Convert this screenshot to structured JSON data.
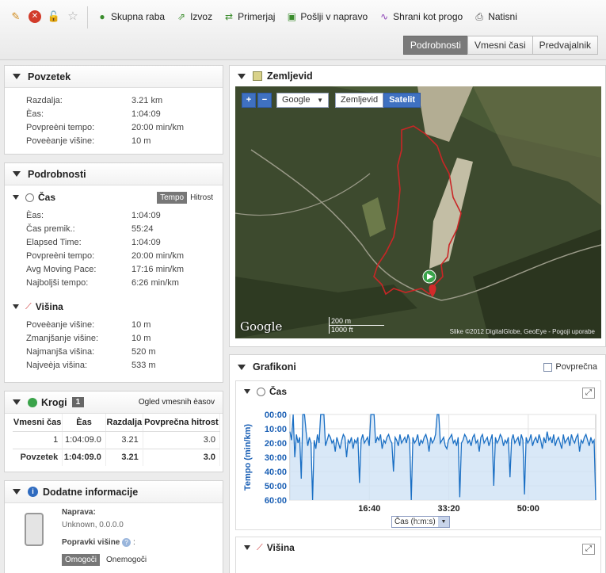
{
  "toolbar": {
    "icons": [
      "pencil-icon",
      "delete-icon",
      "share-icon",
      "star-icon"
    ],
    "actions": [
      {
        "label": "Skupna raba",
        "icon": "group-icon"
      },
      {
        "label": "Izvoz",
        "icon": "export-icon"
      },
      {
        "label": "Primerjaj",
        "icon": "compare-icon"
      },
      {
        "label": "Pošlji v napravo",
        "icon": "send-device-icon"
      },
      {
        "label": "Shrani kot progo",
        "icon": "save-course-icon"
      },
      {
        "label": "Natisni",
        "icon": "print-icon"
      }
    ],
    "view_tabs": [
      "Podrobnosti",
      "Vmesni časi",
      "Predvajalnik"
    ],
    "active_tab": "Podrobnosti"
  },
  "summary": {
    "title": "Povzetek",
    "rows": [
      {
        "label": "Razdalja:",
        "value": "3.21 km"
      },
      {
        "label": "Èas:",
        "value": "1:04:09"
      },
      {
        "label": "Povpreèni tempo:",
        "value": "20:00 min/km"
      },
      {
        "label": "Poveèanje višine:",
        "value": "10 m"
      }
    ]
  },
  "details": {
    "title": "Podrobnosti",
    "time": {
      "title": "Čas",
      "toggle": [
        "Tempo",
        "Hitrost"
      ],
      "rows": [
        {
          "label": "Èas:",
          "value": "1:04:09"
        },
        {
          "label": "Čas premik.:",
          "value": "55:24"
        },
        {
          "label": "Elapsed Time:",
          "value": "1:04:09"
        },
        {
          "label": "Povpreèni tempo:",
          "value": "20:00 min/km"
        },
        {
          "label": "Avg Moving Pace:",
          "value": "17:16 min/km"
        },
        {
          "label": "Najboljši tempo:",
          "value": "6:26 min/km"
        }
      ]
    },
    "elevation": {
      "title": "Višina",
      "rows": [
        {
          "label": "Poveèanje višine:",
          "value": "10 m"
        },
        {
          "label": "Zmanjšanje višine:",
          "value": "10 m"
        },
        {
          "label": "Najmanjša višina:",
          "value": "520 m"
        },
        {
          "label": "Najveèja višina:",
          "value": "533 m"
        }
      ]
    }
  },
  "laps": {
    "title": "Krogi",
    "count": "1",
    "link": "Ogled vmesnih èasov",
    "headers": [
      "Vmesni čas",
      "Èas",
      "Razdalja",
      "Povprečna hitrost"
    ],
    "rows": [
      [
        "1",
        "1:04:09.0",
        "3.21",
        "3.0"
      ]
    ],
    "total": [
      "Povzetek",
      "1:04:09.0",
      "3.21",
      "3.0"
    ]
  },
  "extra": {
    "title": "Dodatne informacije",
    "device_label": "Naprava:",
    "device_value": "Unknown, 0.0.0.0",
    "elev_corr_label": "Popravki višine",
    "elev_corr_suffix": ":",
    "toggle": [
      "Omogoči",
      "Onemogoči"
    ]
  },
  "map": {
    "title": "Zemljevid",
    "provider": "Google",
    "types": [
      "Zemljevid",
      "Satelit"
    ],
    "active_type": "Satelit",
    "scale_m": "200 m",
    "scale_ft": "1000 ft",
    "copyright": "Slike ©2012 DigitalGlobe, GeoEye - Pogoji uporabe",
    "logo": "Google"
  },
  "charts": {
    "title": "Grafikoni",
    "avg_label": "Povprečna",
    "time_chart_title": "Čas",
    "elev_chart_title": "Višina",
    "axis_select": "Čas (h:m:s)",
    "colors": {
      "line": "#1a6fc4",
      "fill": "#cfe2f5"
    }
  },
  "chart_data": {
    "type": "area",
    "title": "",
    "ylabel": "Tempo (min/km)",
    "xlabel": "Čas (h:m:s)",
    "y_ticks": [
      "00:00",
      "10:00",
      "20:00",
      "30:00",
      "40:00",
      "50:00",
      "60:00"
    ],
    "x_ticks": [
      "16:40",
      "33:20",
      "50:00"
    ],
    "ylim": [
      0,
      60
    ],
    "y_inverted": true,
    "xlim_minutes": [
      0,
      64.15
    ],
    "series": [
      {
        "values": [
          12,
          18,
          0,
          30,
          14,
          20,
          16,
          45,
          0,
          0,
          12,
          22,
          16,
          20,
          60,
          18,
          24,
          14,
          20,
          0,
          0,
          0,
          22,
          18,
          14,
          16,
          20,
          18,
          26,
          16,
          20,
          24,
          18,
          14,
          16,
          30,
          18,
          20,
          16,
          24,
          18,
          20,
          16,
          48,
          18,
          14,
          20,
          18,
          16,
          22,
          0,
          0,
          0,
          20,
          16,
          18,
          14,
          24,
          18,
          20,
          16,
          14,
          18,
          20,
          40,
          16,
          18,
          22,
          14,
          20,
          18,
          16,
          20,
          14,
          18,
          60,
          16,
          20,
          18,
          14,
          22,
          18,
          20,
          16,
          14,
          18,
          26,
          16,
          20,
          18,
          14,
          0,
          0,
          20,
          18,
          16,
          22,
          24,
          18,
          16,
          14,
          20,
          18,
          22,
          16,
          58,
          20,
          18,
          14,
          16,
          20,
          18,
          22,
          16,
          14,
          20,
          18,
          26,
          16,
          14,
          20,
          18,
          16,
          22,
          18,
          14,
          50,
          16,
          20,
          18,
          14,
          16,
          22,
          18,
          20,
          16,
          44,
          18,
          14,
          20,
          18,
          16,
          22,
          14,
          18,
          56,
          16,
          20,
          18,
          14,
          22,
          18,
          16,
          20,
          14,
          18,
          24,
          16,
          20,
          12,
          18,
          16,
          20,
          14,
          22,
          18,
          16,
          20,
          24,
          14,
          20,
          18,
          16,
          22,
          14,
          18,
          20,
          16,
          14,
          26,
          18,
          20,
          16,
          14,
          18,
          22,
          16,
          20,
          18,
          60
        ]
      }
    ]
  }
}
